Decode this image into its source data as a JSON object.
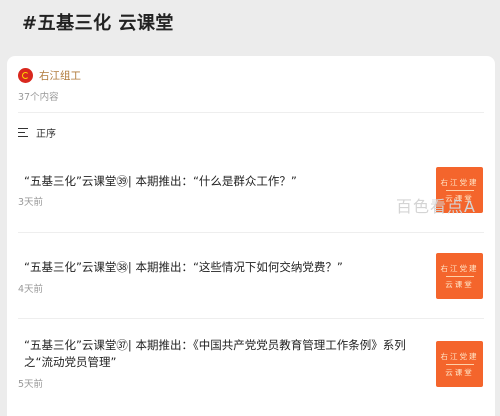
{
  "topic": {
    "title": "#五基三化 云课堂"
  },
  "account": {
    "name": "右江组工"
  },
  "content_count": "37个内容",
  "sort": {
    "label": "正序"
  },
  "articles": [
    {
      "title": "“五基三化”云课堂㊴| 本期推出：“什么是群众工作？”",
      "time": "3天前",
      "thumb_line1": "右江党建",
      "thumb_line2": "云课堂"
    },
    {
      "title": "“五基三化”云课堂㊳| 本期推出：“这些情况下如何交纳党费？”",
      "time": "4天前",
      "thumb_line1": "右江党建",
      "thumb_line2": "云课堂"
    },
    {
      "title": "“五基三化”云课堂㊲| 本期推出：《中国共产党党员教育管理工作条例》系列之“流动党员管理”",
      "time": "5天前",
      "thumb_line1": "右江党建",
      "thumb_line2": "云课堂"
    }
  ],
  "watermark": "百色看点A"
}
